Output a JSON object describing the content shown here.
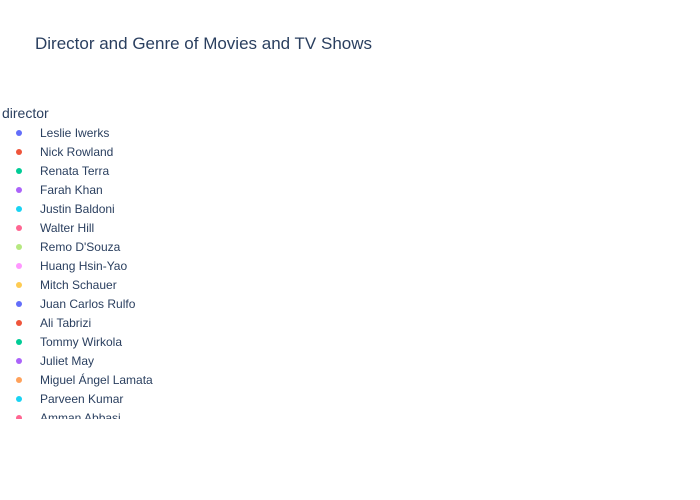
{
  "chart_data": {
    "type": "scatter",
    "title": "Director and Genre of Movies and TV Shows",
    "legend": {
      "title": "director",
      "placement": "left",
      "entries": [
        {
          "name": "Leslie Iwerks",
          "color": "#636efa"
        },
        {
          "name": "Nick Rowland",
          "color": "#EF553B"
        },
        {
          "name": "Renata Terra",
          "color": "#00cc96"
        },
        {
          "name": "Farah Khan",
          "color": "#ab63fa"
        },
        {
          "name": "Justin Baldoni",
          "color": "#19d3f3"
        },
        {
          "name": "Walter Hill",
          "color": "#FF6692"
        },
        {
          "name": "Remo D'Souza",
          "color": "#B6E880"
        },
        {
          "name": "Huang Hsin-Yao",
          "color": "#FF97FF"
        },
        {
          "name": "Mitch Schauer",
          "color": "#FECB52"
        },
        {
          "name": "Juan Carlos Rulfo",
          "color": "#636efa"
        },
        {
          "name": "Ali Tabrizi",
          "color": "#EF553B"
        },
        {
          "name": "Tommy Wirkola",
          "color": "#00cc96"
        },
        {
          "name": "Juliet May",
          "color": "#ab63fa"
        },
        {
          "name": "Miguel Ángel Lamata",
          "color": "#FFA15A"
        },
        {
          "name": "Parveen Kumar",
          "color": "#19d3f3"
        },
        {
          "name": "Amman Abbasi",
          "color": "#FF6692"
        }
      ]
    },
    "series": []
  }
}
